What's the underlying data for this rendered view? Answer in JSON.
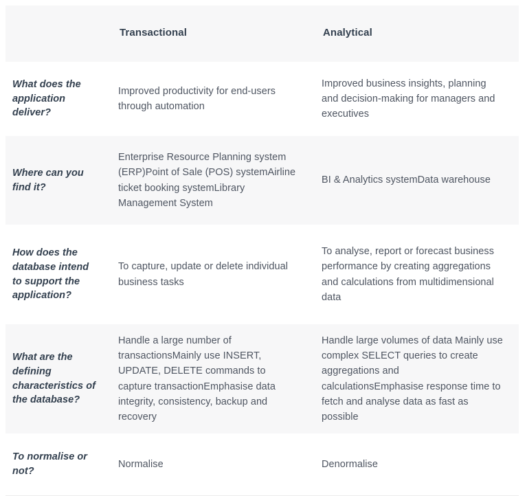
{
  "table": {
    "columns": [
      {
        "key": "label",
        "header": ""
      },
      {
        "key": "transactional",
        "header": "Transactional"
      },
      {
        "key": "analytical",
        "header": "Analytical"
      }
    ],
    "rows": [
      {
        "label": "What does the application deliver?",
        "transactional": "Improved productivity for end-users through automation",
        "analytical": "Improved business insights, planning and decision-making for managers and executives"
      },
      {
        "label": "Where can you find it?",
        "transactional": "Enterprise Resource Planning system (ERP)Point of Sale (POS) systemAirline ticket booking systemLibrary Management System",
        "analytical": "BI & Analytics systemData warehouse"
      },
      {
        "label": "How does the database intend to support the application?",
        "transactional": "To capture, update or delete individual business tasks",
        "analytical": "To analyse, report or forecast business performance by creating aggregations and calculations from multidimensional data"
      },
      {
        "label": "What are the defining characteristics of the database?",
        "transactional": "Handle a large number of transactionsMainly use INSERT, UPDATE, DELETE commands to capture transactionEmphasise data integrity, consistency, backup and recovery",
        "analytical": "Handle large volumes of data Mainly use complex SELECT queries to create aggregations and calculationsEmphasise response time to fetch and analyse data as fast as possible"
      },
      {
        "label": "To normalise or not?",
        "transactional": "Normalise",
        "analytical": "Denormalise"
      }
    ]
  },
  "colors": {
    "shaded_row_background": "#f7f7f8",
    "plain_row_background": "#ffffff",
    "label_text": "#33404f",
    "body_text": "#4e5561",
    "bottom_border": "#ececed"
  }
}
